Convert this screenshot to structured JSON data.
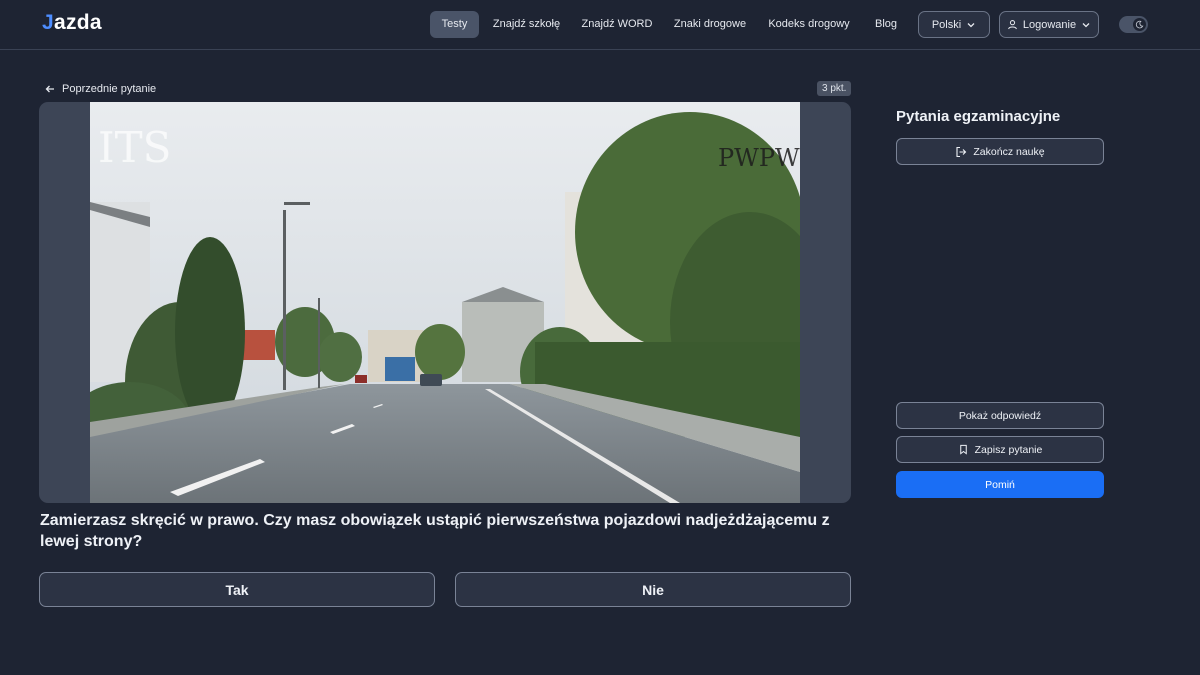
{
  "header": {
    "logo_mark": "J",
    "logo_rest": "azda",
    "nav": [
      {
        "label": "Testy",
        "active": true
      },
      {
        "label": "Znajdź szkołę",
        "active": false
      },
      {
        "label": "Znajdź WORD",
        "active": false
      },
      {
        "label": "Znaki drogowe",
        "active": false
      },
      {
        "label": "Kodeks drogowy",
        "active": false
      },
      {
        "label": "Blog",
        "active": false
      }
    ],
    "language": "Polski",
    "login": "Logowanie",
    "theme_icon": "moon-icon"
  },
  "main": {
    "back_label": "Poprzednie pytanie",
    "points": "3 pkt.",
    "media_watermarks": {
      "left": "ITS",
      "right": "PWPW"
    },
    "question": "Zamierzasz skręcić w prawo. Czy masz obowiązek ustąpić pierwszeństwa pojazdowi nadjeżdżającemu z lewej strony?",
    "answers": [
      "Tak",
      "Nie"
    ]
  },
  "sidebar": {
    "title": "Pytania egzaminacyjne",
    "end_label": "Zakończ naukę",
    "show_answer_label": "Pokaż odpowiedź",
    "save_label": "Zapisz pytanie",
    "skip_label": "Pomiń"
  },
  "colors": {
    "background": "#1e2433",
    "primary": "#1a6ef5",
    "logo_accent": "#4d8dff"
  }
}
